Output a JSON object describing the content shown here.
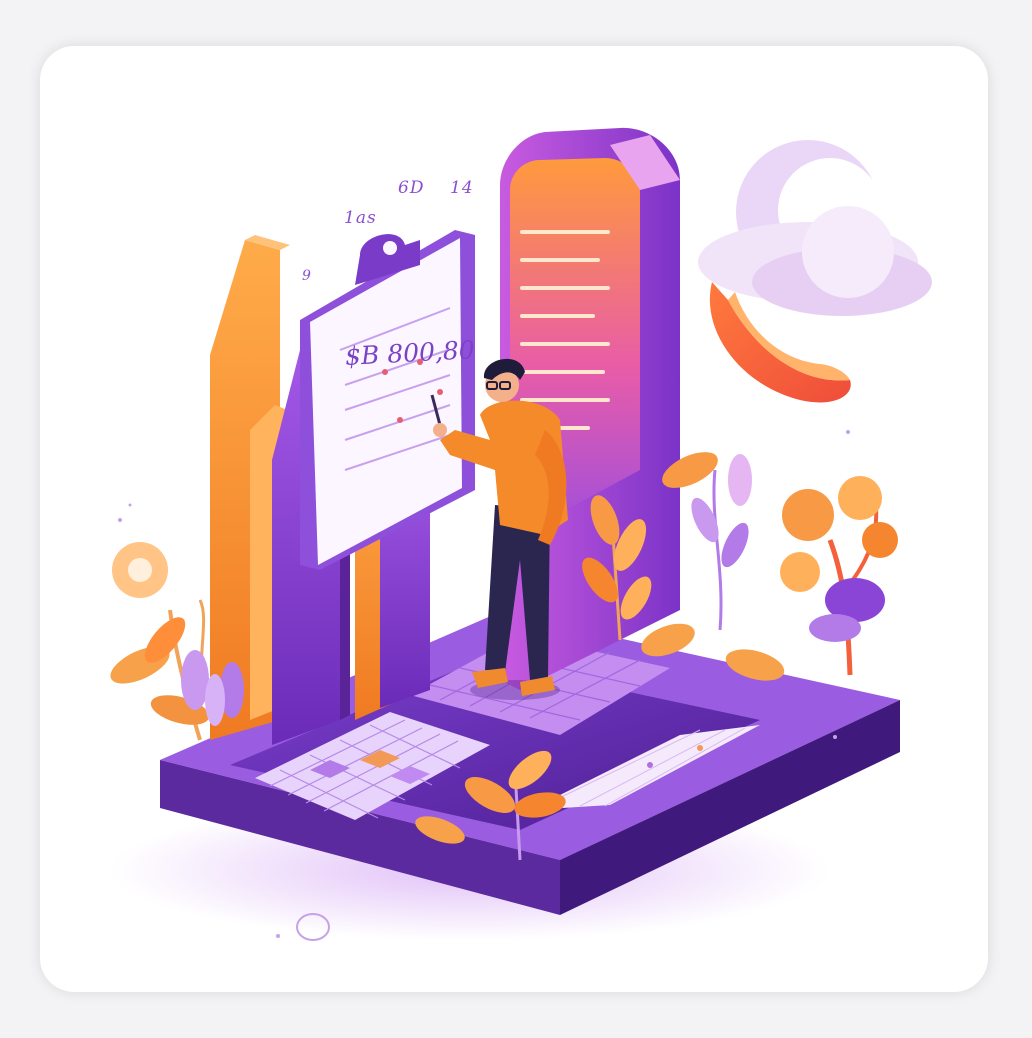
{
  "illustration": {
    "labels": {
      "top_left": "1as",
      "top_mid": "6D",
      "top_right": "14",
      "side_small": "9",
      "screen_amount": "$B 800,80"
    }
  },
  "colors": {
    "purple_dark": "#5b2a9e",
    "purple": "#8b45d6",
    "purple_light": "#c9a2f2",
    "orange": "#f58a2b",
    "orange_light": "#ffbf73",
    "coral": "#f5603c",
    "background": "#ffffff"
  },
  "icons": [
    "person-icon",
    "plant-icon",
    "cloud-icon",
    "crescent-moon-icon",
    "bar-chart-icon",
    "clipboard-icon"
  ]
}
